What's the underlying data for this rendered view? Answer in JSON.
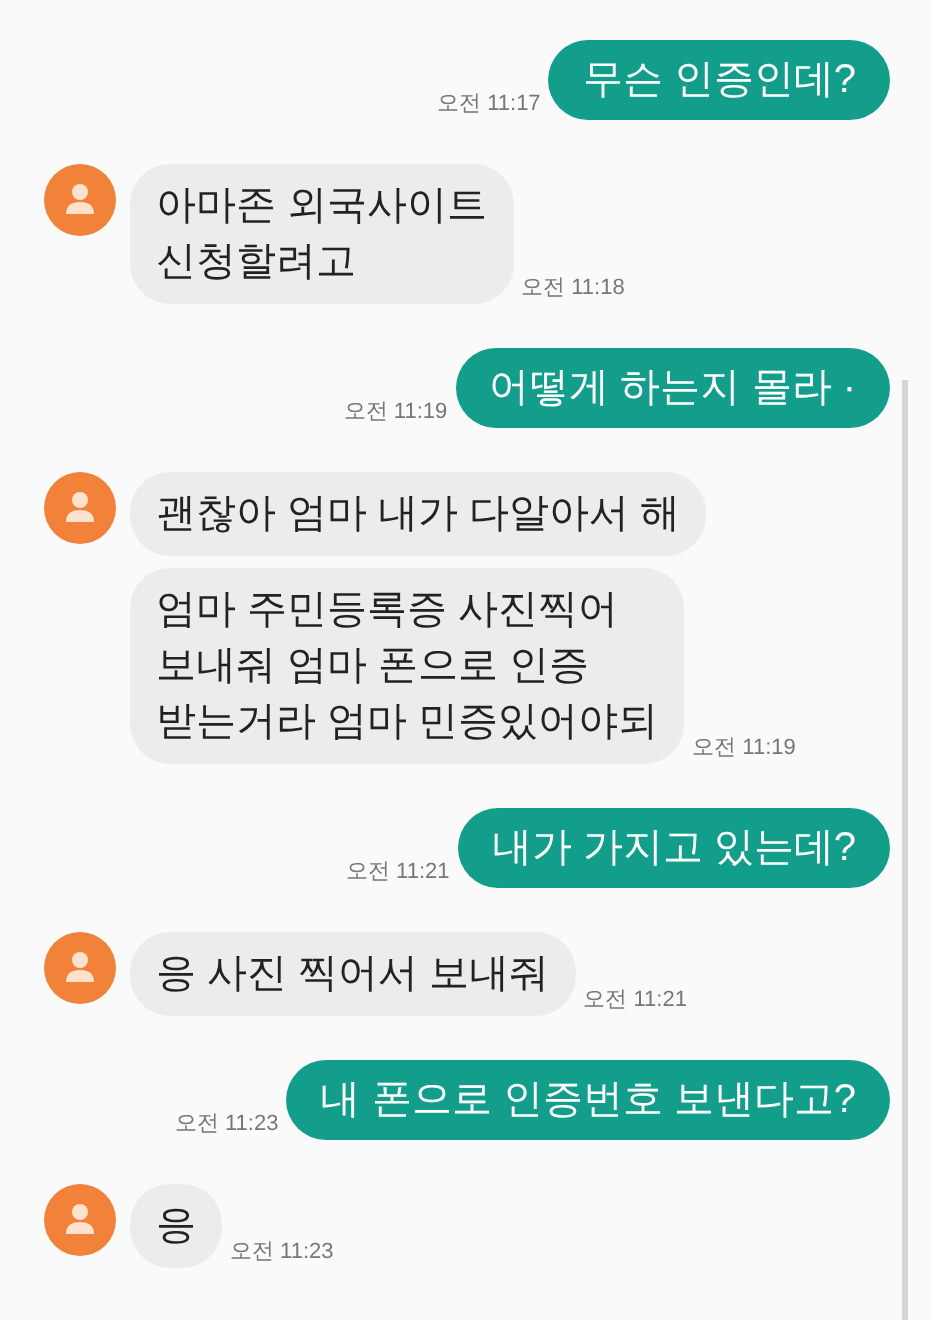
{
  "messages": [
    {
      "kind": "sent",
      "bubbles": [
        {
          "text": "무슨 인증인데?",
          "time": "오전 11:17"
        }
      ]
    },
    {
      "kind": "received",
      "bubbles": [
        {
          "text": "아마존 외국사이트\n신청할려고",
          "time": "오전 11:18"
        }
      ]
    },
    {
      "kind": "sent",
      "bubbles": [
        {
          "text": "어떻게 하는지 몰라 ·",
          "time": "오전 11:19"
        }
      ]
    },
    {
      "kind": "received",
      "bubbles": [
        {
          "text": "괜찮아 엄마 내가 다알아서 해"
        },
        {
          "text": "엄마 주민등록증 사진찍어\n보내줘 엄마 폰으로 인증\n받는거라 엄마 민증있어야되",
          "time": "오전 11:19"
        }
      ]
    },
    {
      "kind": "sent",
      "bubbles": [
        {
          "text": "내가 가지고 있는데?",
          "time": "오전 11:21"
        }
      ]
    },
    {
      "kind": "received",
      "bubbles": [
        {
          "text": "응 사진 찍어서 보내줘",
          "time": "오전 11:21"
        }
      ]
    },
    {
      "kind": "sent",
      "bubbles": [
        {
          "text": "내 폰으로 인증번호 보낸다고?",
          "time": "오전 11:23"
        }
      ]
    },
    {
      "kind": "received",
      "bubbles": [
        {
          "text": "응",
          "time": "오전 11:23"
        }
      ]
    }
  ]
}
